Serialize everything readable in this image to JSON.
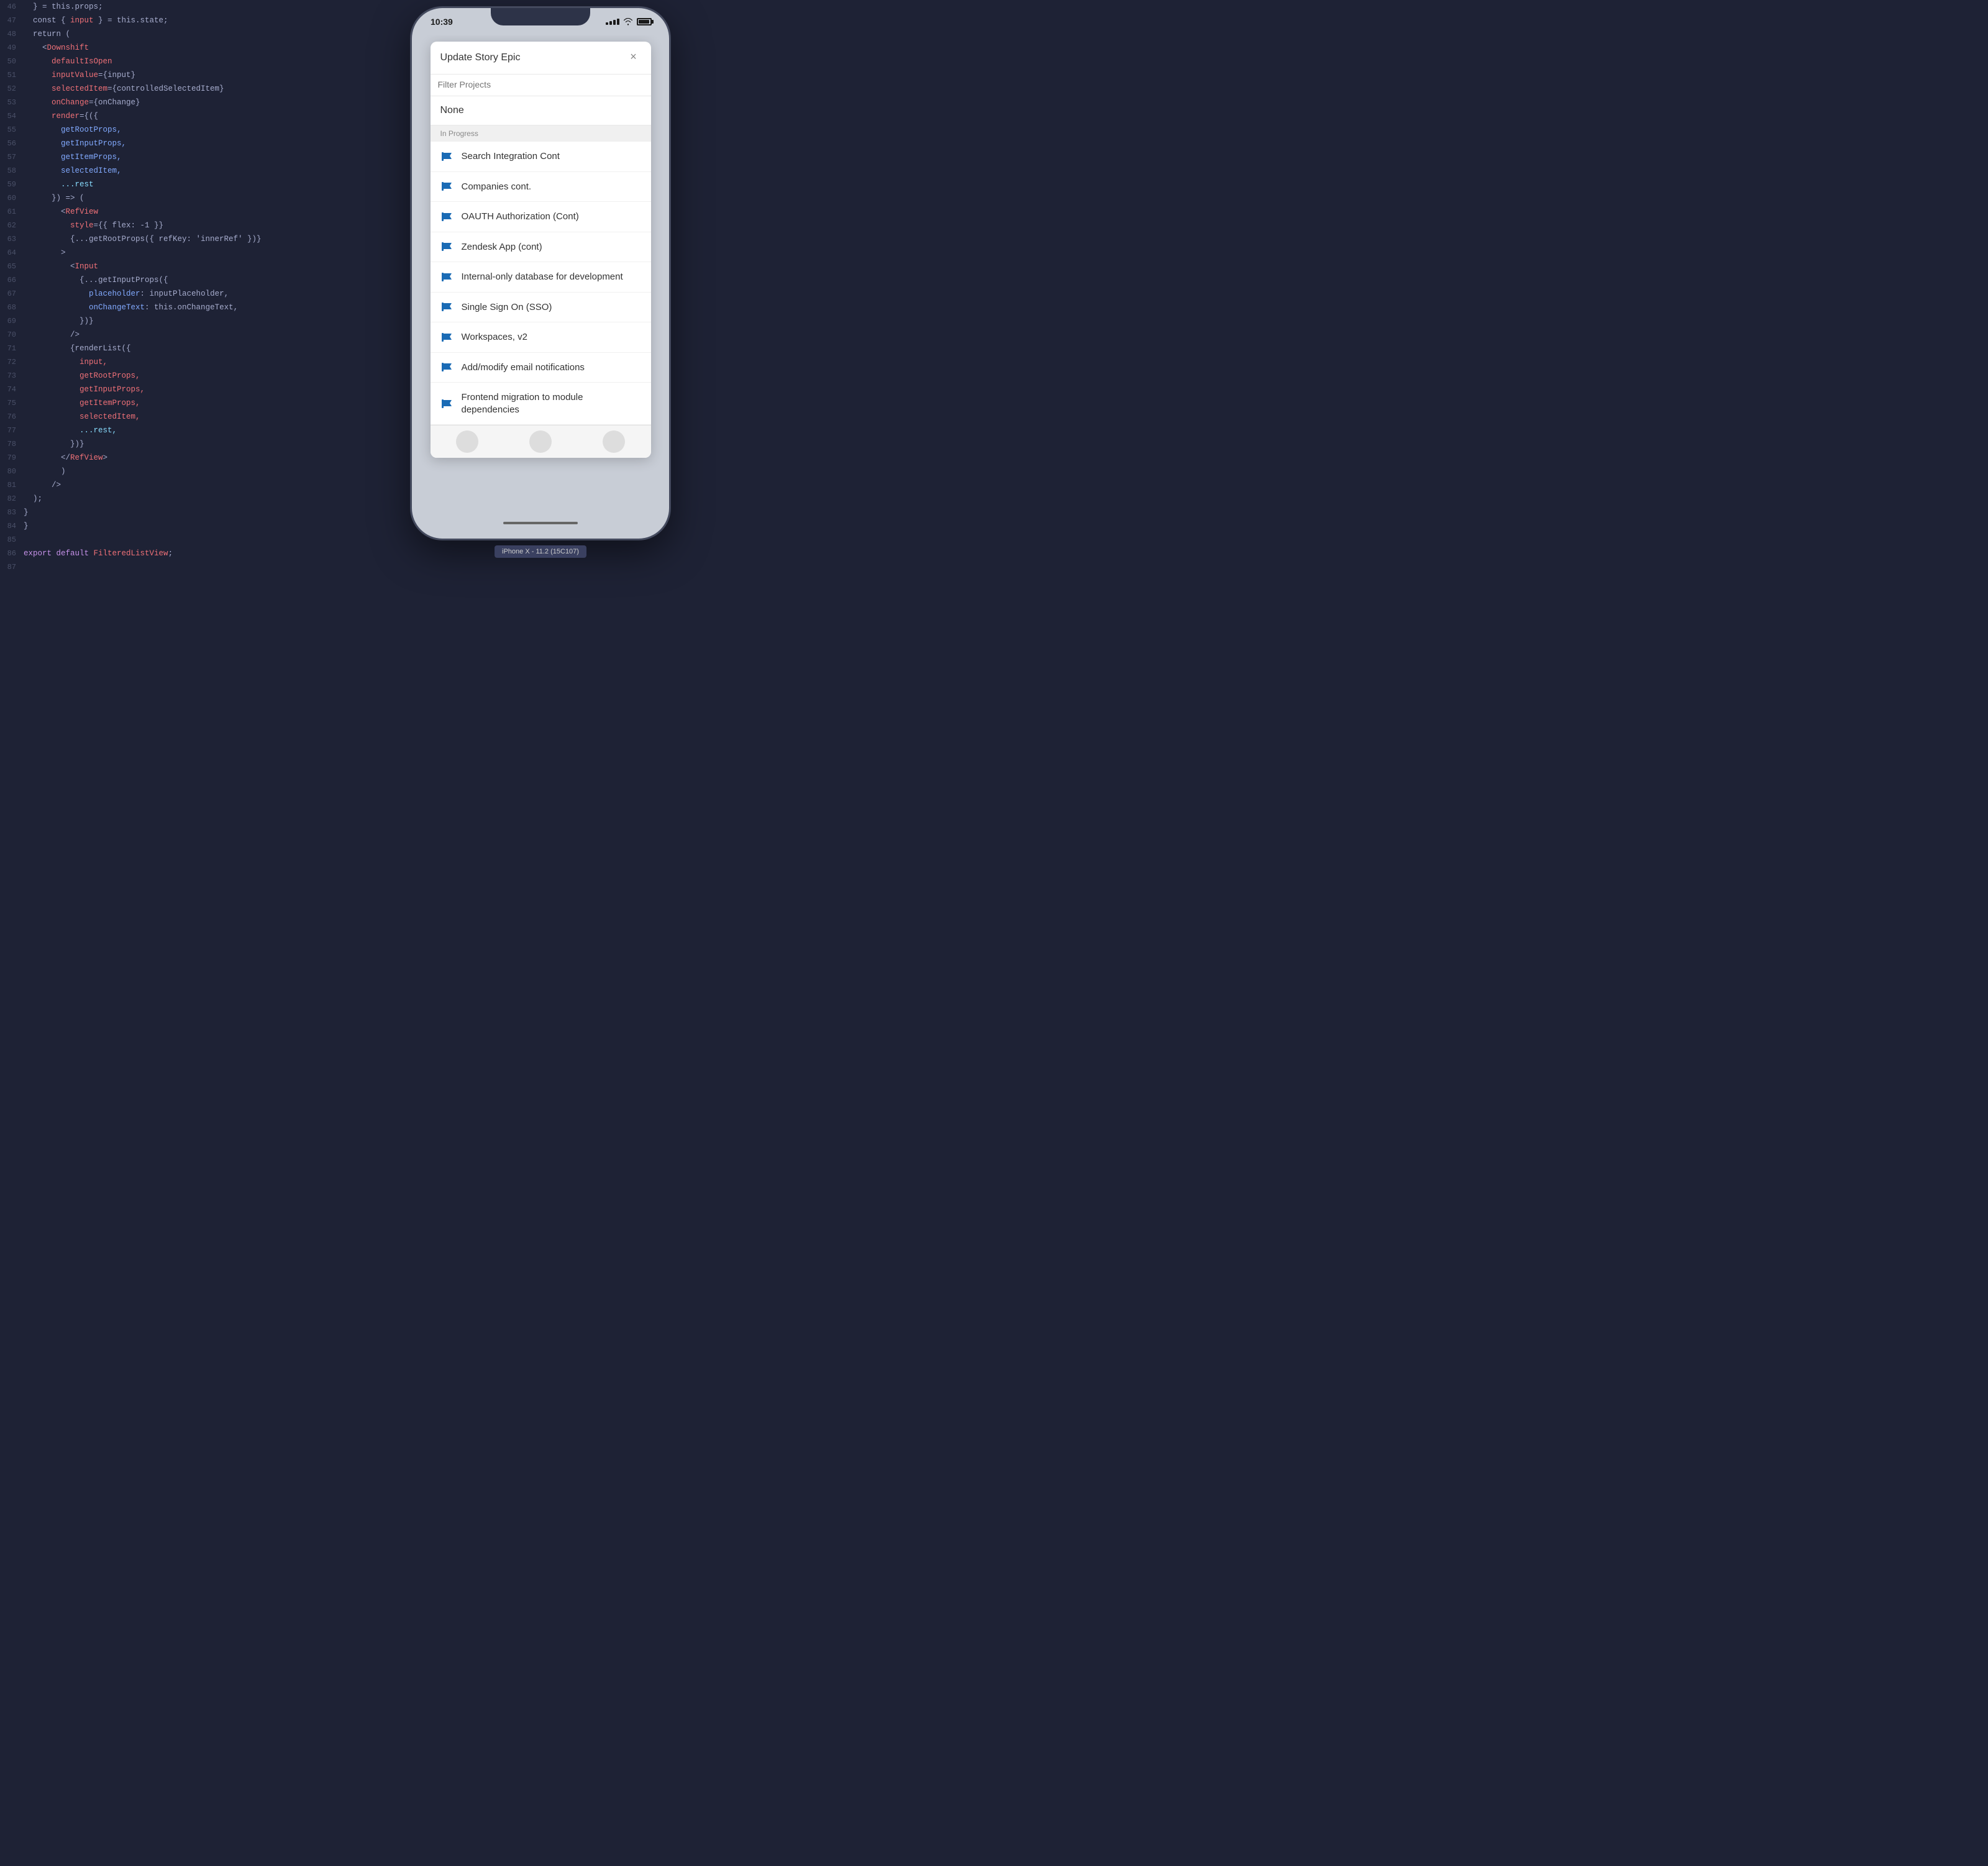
{
  "editor": {
    "background": "#1e2235",
    "lines": [
      {
        "num": 46,
        "tokens": [
          {
            "text": "  } = this.props;",
            "color": "#a6accd"
          }
        ]
      },
      {
        "num": 47,
        "tokens": [
          {
            "text": "  const { ",
            "color": "#a6accd"
          },
          {
            "text": "input",
            "color": "#f07178"
          },
          {
            "text": " } = this.state;",
            "color": "#a6accd"
          }
        ]
      },
      {
        "num": 48,
        "tokens": [
          {
            "text": "  return (",
            "color": "#a6accd"
          }
        ]
      },
      {
        "num": 49,
        "tokens": [
          {
            "text": "    <",
            "color": "#a6accd"
          },
          {
            "text": "Downshift",
            "color": "#f07178"
          }
        ]
      },
      {
        "num": 50,
        "tokens": [
          {
            "text": "      ",
            "color": "#a6accd"
          },
          {
            "text": "defaultIsOpen",
            "color": "#f07178"
          }
        ]
      },
      {
        "num": 51,
        "tokens": [
          {
            "text": "      ",
            "color": "#a6accd"
          },
          {
            "text": "inputValue",
            "color": "#f07178"
          },
          {
            "text": "={input}",
            "color": "#a6accd"
          }
        ]
      },
      {
        "num": 52,
        "tokens": [
          {
            "text": "      ",
            "color": "#a6accd"
          },
          {
            "text": "selectedItem",
            "color": "#f07178"
          },
          {
            "text": "={controlledSelectedItem}",
            "color": "#a6accd"
          }
        ]
      },
      {
        "num": 53,
        "tokens": [
          {
            "text": "      ",
            "color": "#a6accd"
          },
          {
            "text": "onChange",
            "color": "#f07178"
          },
          {
            "text": "={onChange}",
            "color": "#a6accd"
          }
        ]
      },
      {
        "num": 54,
        "tokens": [
          {
            "text": "      ",
            "color": "#a6accd"
          },
          {
            "text": "render",
            "color": "#f07178"
          },
          {
            "text": "={({",
            "color": "#a6accd"
          }
        ]
      },
      {
        "num": 55,
        "tokens": [
          {
            "text": "        ",
            "color": "#a6accd"
          },
          {
            "text": "getRootProps,",
            "color": "#82aaff"
          }
        ]
      },
      {
        "num": 56,
        "tokens": [
          {
            "text": "        ",
            "color": "#a6accd"
          },
          {
            "text": "getInputProps,",
            "color": "#82aaff"
          }
        ]
      },
      {
        "num": 57,
        "tokens": [
          {
            "text": "        ",
            "color": "#a6accd"
          },
          {
            "text": "getItemProps,",
            "color": "#82aaff"
          }
        ]
      },
      {
        "num": 58,
        "tokens": [
          {
            "text": "        ",
            "color": "#a6accd"
          },
          {
            "text": "selectedItem,",
            "color": "#82aaff"
          }
        ]
      },
      {
        "num": 59,
        "tokens": [
          {
            "text": "        ",
            "color": "#a6accd"
          },
          {
            "text": "...rest",
            "color": "#89ddff"
          }
        ]
      },
      {
        "num": 60,
        "tokens": [
          {
            "text": "      }) => (",
            "color": "#a6accd"
          }
        ]
      },
      {
        "num": 61,
        "tokens": [
          {
            "text": "        <",
            "color": "#a6accd"
          },
          {
            "text": "RefView",
            "color": "#f07178"
          }
        ]
      },
      {
        "num": 62,
        "tokens": [
          {
            "text": "          ",
            "color": "#a6accd"
          },
          {
            "text": "style",
            "color": "#f07178"
          },
          {
            "text": "={{ flex: -1 }}",
            "color": "#a6accd"
          }
        ]
      },
      {
        "num": 63,
        "tokens": [
          {
            "text": "          {...getRootProps({ refKey: 'innerRef' })}",
            "color": "#a6accd"
          }
        ]
      },
      {
        "num": 64,
        "tokens": [
          {
            "text": "        >",
            "color": "#a6accd"
          }
        ]
      },
      {
        "num": 65,
        "tokens": [
          {
            "text": "          <",
            "color": "#a6accd"
          },
          {
            "text": "Input",
            "color": "#f07178"
          }
        ]
      },
      {
        "num": 66,
        "tokens": [
          {
            "text": "            {...getInputProps({",
            "color": "#a6accd"
          }
        ]
      },
      {
        "num": 67,
        "tokens": [
          {
            "text": "              ",
            "color": "#a6accd"
          },
          {
            "text": "placeholder",
            "color": "#82aaff"
          },
          {
            "text": ": inputPlaceholder,",
            "color": "#a6accd"
          }
        ]
      },
      {
        "num": 68,
        "tokens": [
          {
            "text": "              ",
            "color": "#a6accd"
          },
          {
            "text": "onChangeText",
            "color": "#82aaff"
          },
          {
            "text": ": this.onChangeText,",
            "color": "#a6accd"
          }
        ]
      },
      {
        "num": 69,
        "tokens": [
          {
            "text": "            })}",
            "color": "#a6accd"
          }
        ]
      },
      {
        "num": 70,
        "tokens": [
          {
            "text": "          />",
            "color": "#a6accd"
          }
        ]
      },
      {
        "num": 71,
        "tokens": [
          {
            "text": "          {renderList({",
            "color": "#a6accd"
          }
        ]
      },
      {
        "num": 72,
        "tokens": [
          {
            "text": "            ",
            "color": "#a6accd"
          },
          {
            "text": "input,",
            "color": "#f07178"
          }
        ]
      },
      {
        "num": 73,
        "tokens": [
          {
            "text": "            ",
            "color": "#a6accd"
          },
          {
            "text": "getRootProps,",
            "color": "#f07178"
          }
        ]
      },
      {
        "num": 74,
        "tokens": [
          {
            "text": "            ",
            "color": "#a6accd"
          },
          {
            "text": "getInputProps,",
            "color": "#f07178"
          }
        ]
      },
      {
        "num": 75,
        "tokens": [
          {
            "text": "            ",
            "color": "#a6accd"
          },
          {
            "text": "getItemProps,",
            "color": "#f07178"
          }
        ]
      },
      {
        "num": 76,
        "tokens": [
          {
            "text": "            ",
            "color": "#a6accd"
          },
          {
            "text": "selectedItem,",
            "color": "#f07178"
          }
        ]
      },
      {
        "num": 77,
        "tokens": [
          {
            "text": "            ",
            "color": "#a6accd"
          },
          {
            "text": "...rest,",
            "color": "#89ddff"
          }
        ]
      },
      {
        "num": 78,
        "tokens": [
          {
            "text": "          })}",
            "color": "#a6accd"
          }
        ]
      },
      {
        "num": 79,
        "tokens": [
          {
            "text": "        </",
            "color": "#a6accd"
          },
          {
            "text": "RefView",
            "color": "#f07178"
          },
          {
            "text": ">",
            "color": "#a6accd"
          }
        ]
      },
      {
        "num": 80,
        "tokens": [
          {
            "text": "        )",
            "color": "#a6accd"
          }
        ]
      },
      {
        "num": 81,
        "tokens": [
          {
            "text": "      />",
            "color": "#a6accd"
          }
        ]
      },
      {
        "num": 82,
        "tokens": [
          {
            "text": "  );",
            "color": "#a6accd"
          }
        ]
      },
      {
        "num": 83,
        "tokens": [
          {
            "text": "}",
            "color": "#a6accd"
          }
        ]
      },
      {
        "num": 84,
        "tokens": [
          {
            "text": "}",
            "color": "#a6accd"
          }
        ]
      },
      {
        "num": 85,
        "tokens": [
          {
            "text": "",
            "color": "#a6accd"
          }
        ]
      },
      {
        "num": 86,
        "tokens": [
          {
            "text": "export default ",
            "color": "#c792ea"
          },
          {
            "text": "FilteredListView",
            "color": "#f07178"
          },
          {
            "text": ";",
            "color": "#a6accd"
          }
        ]
      },
      {
        "num": 87,
        "tokens": [
          {
            "text": "",
            "color": "#a6accd"
          }
        ]
      }
    ]
  },
  "phone": {
    "status": {
      "time": "10:39",
      "battery_label": "battery",
      "signal_label": "signal"
    },
    "device_label": "iPhone X - 11.2 (15C107)",
    "modal": {
      "title": "Update Story Epic",
      "close_label": "×",
      "search_placeholder": "Filter Projects",
      "none_label": "None",
      "section_label": "In Progress",
      "items": [
        {
          "label": "Search Integration Cont"
        },
        {
          "label": "Companies cont."
        },
        {
          "label": "OAUTH Authorization (Cont)"
        },
        {
          "label": "Zendesk App (cont)"
        },
        {
          "label": "Internal-only database for development"
        },
        {
          "label": "Single Sign On (SSO)"
        },
        {
          "label": "Workspaces, v2"
        },
        {
          "label": "Add/modify email notifications"
        },
        {
          "label": "Frontend migration to module dependencies"
        }
      ]
    }
  }
}
